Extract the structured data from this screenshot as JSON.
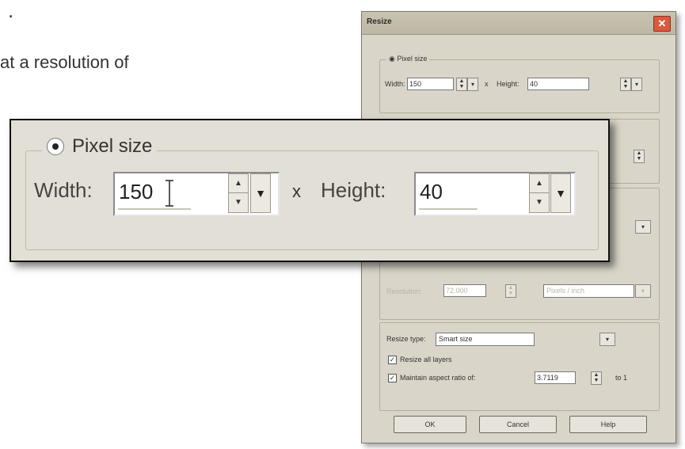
{
  "document": {
    "line_top": ".",
    "line_partial": "at a resolution of"
  },
  "dialog": {
    "title": "Resize",
    "close_icon": "close-icon",
    "pixel_size": {
      "legend": "Pixel size",
      "width_label": "Width:",
      "width_value": "150",
      "x_separator": "x",
      "height_label": "Height:",
      "height_value": "40"
    },
    "resolution": {
      "label": "Resolution:",
      "value": "72.000",
      "unit": "Pixels / inch"
    },
    "resize_type": {
      "label": "Resize type:",
      "value": "Smart size"
    },
    "resize_all_layers": {
      "label": "Resize all layers",
      "checked": true
    },
    "aspect": {
      "label": "Maintain aspect ratio of:",
      "value": "3.7119",
      "suffix": "to 1",
      "checked": true
    },
    "buttons": {
      "ok": "OK",
      "cancel": "Cancel",
      "help": "Help"
    }
  },
  "zoom": {
    "legend": "Pixel size",
    "width_label": "Width:",
    "width_value": "150",
    "x_separator": "x",
    "height_label": "Height:",
    "height_value": "40"
  }
}
